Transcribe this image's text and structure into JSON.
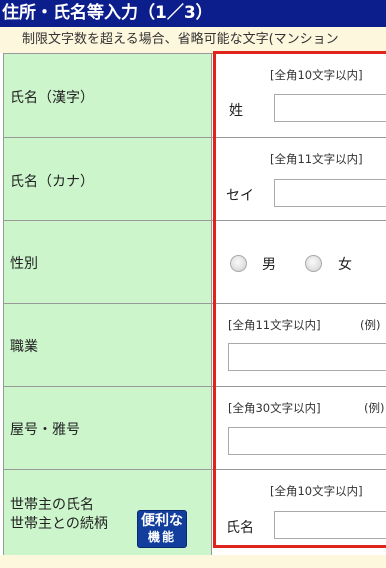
{
  "header": {
    "title": "住所・氏名等入力（1／3）"
  },
  "notice": {
    "text": "制限文字数を超える場合、省略可能な文字(マンション"
  },
  "form": {
    "name_kanji": {
      "label": "氏名（漢字）",
      "limit": "[全角10文字以内]",
      "prefix": "姓"
    },
    "name_kana": {
      "label": "氏名（カナ）",
      "limit": "[全角11文字以内]",
      "prefix": "セイ"
    },
    "gender": {
      "label": "性別",
      "options": [
        "男",
        "女"
      ]
    },
    "occupation": {
      "label": "職業",
      "limit": "[全角11文字以内]",
      "example": "(例)"
    },
    "trade_name": {
      "label": "屋号・雅号",
      "limit": "[全角30文字以内]",
      "example": "(例)"
    },
    "householder": {
      "label_line1": "世帯主の氏名",
      "label_line2": "世帯主との続柄",
      "badge_line1": "便利な",
      "badge_line2": "機能",
      "limit": "[全角10文字以内]",
      "prefix": "氏名"
    }
  }
}
